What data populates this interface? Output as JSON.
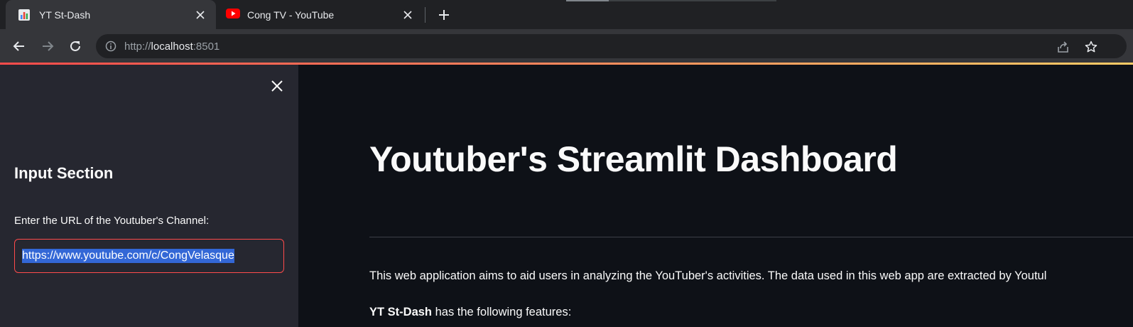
{
  "browser": {
    "tabs": [
      {
        "title": "YT St-Dash",
        "active": true,
        "favicon": "bar-chart-icon"
      },
      {
        "title": "Cong TV - YouTube",
        "active": false,
        "favicon": "youtube-icon"
      }
    ],
    "url": {
      "scheme": "http://",
      "host": "localhost",
      "port": ":8501"
    }
  },
  "sidebar": {
    "heading": "Input Section",
    "input_label": "Enter the URL of the Youtuber's Channel:",
    "input_value": "https://www.youtube.com/c/CongVelasque"
  },
  "main": {
    "title": "Youtuber's Streamlit Dashboard",
    "intro": "This web application aims to aid users in analyzing the YouTuber's activities. The data used in this web app are extracted by Youtul",
    "features_bold": "YT St-Dash",
    "features_rest": " has the following features:"
  },
  "colors": {
    "accent": "#ff4b4b",
    "background": "#0e1117",
    "sidebar_bg": "#262730",
    "selection": "#3367d6"
  }
}
